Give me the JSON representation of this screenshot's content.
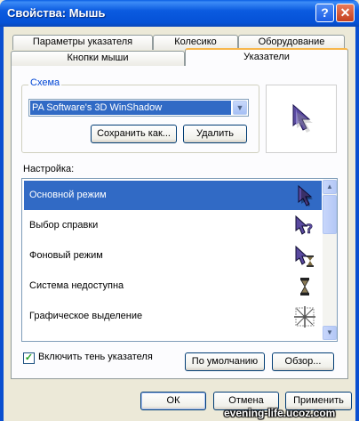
{
  "window": {
    "title": "Свойства: Мышь"
  },
  "tabs": {
    "row_back": [
      "Параметры указателя",
      "Колесико",
      "Оборудование"
    ],
    "row_front": [
      "Кнопки мыши",
      "Указатели"
    ],
    "active": "Указатели"
  },
  "scheme": {
    "legend": "Схема",
    "selected": "PA Software's 3D WinShadow",
    "save_as": "Сохранить как...",
    "delete": "Удалить"
  },
  "settings": {
    "label": "Настройка:",
    "items": [
      {
        "label": "Основной режим",
        "icon": "arrow-cursor-icon",
        "selected": true
      },
      {
        "label": "Выбор справки",
        "icon": "help-select-cursor-icon",
        "selected": false
      },
      {
        "label": "Фоновый режим",
        "icon": "working-in-background-cursor-icon",
        "selected": false
      },
      {
        "label": "Система недоступна",
        "icon": "hourglass-busy-cursor-icon",
        "selected": false
      },
      {
        "label": "Графическое выделение",
        "icon": "precision-select-cursor-icon",
        "selected": false
      }
    ]
  },
  "shadow": {
    "label": "Включить тень указателя",
    "checked": true
  },
  "buttons": {
    "default": "По умолчанию",
    "browse": "Обзор...",
    "ok": "ОК",
    "cancel": "Отмена",
    "apply": "Применить"
  },
  "watermark": "evening-life.ucoz.com",
  "colors": {
    "title_bar": "#0b5be0",
    "selection": "#316ac5",
    "tab_highlight": "#f7b64a"
  }
}
